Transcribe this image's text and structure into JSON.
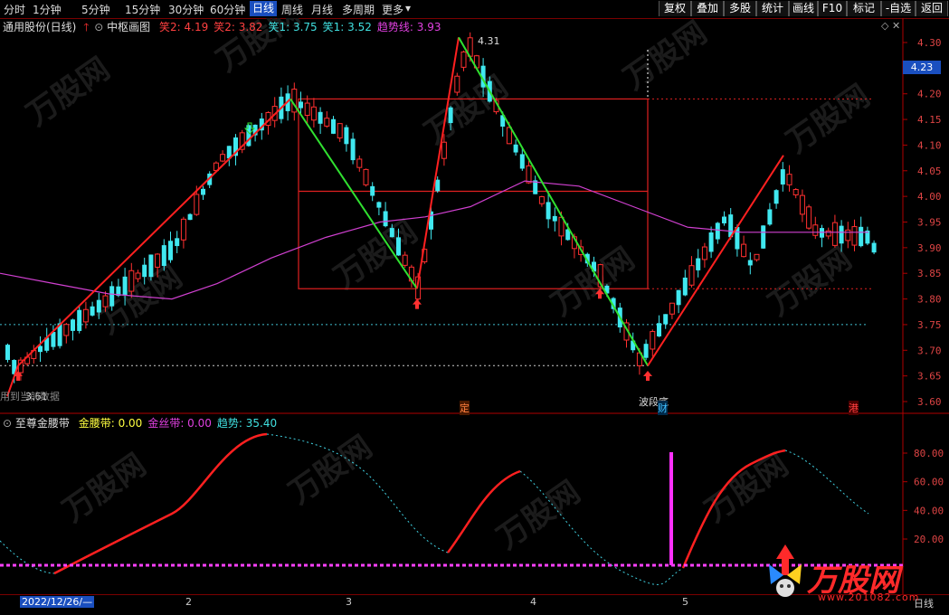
{
  "toolbar": {
    "periods": [
      "分时",
      "1分钟",
      "5分钟",
      "15分钟",
      "30分钟",
      "60分钟",
      "日线",
      "周线",
      "月线",
      "多周期",
      "更多"
    ],
    "active_period": "日线",
    "right_buttons": [
      "复权",
      "叠加",
      "多股",
      "统计",
      "画线",
      "F10",
      "标记",
      "-自选",
      "返回"
    ]
  },
  "main": {
    "stock_title": "通用股份(日线)",
    "indicator_name": "中枢画图",
    "legend": [
      {
        "label": "笑2:",
        "value": "4.19",
        "color": "#ff4040"
      },
      {
        "label": "笑2:",
        "value": "3.82",
        "color": "#ff4040"
      },
      {
        "label": "笑1:",
        "value": "3.75",
        "color": "#40e0e0"
      },
      {
        "label": "笑1:",
        "value": "3.52",
        "color": "#40e0e0"
      },
      {
        "label": "趋势线:",
        "value": "3.93",
        "color": "#e040e0"
      }
    ],
    "price_ticks": [
      "4.30",
      "4.25",
      "4.20",
      "4.15",
      "4.10",
      "4.05",
      "4.00",
      "3.95",
      "3.90",
      "3.85",
      "3.80",
      "3.75",
      "3.70",
      "3.65",
      "3.60"
    ],
    "current_price": "4.23",
    "high_label": "4.31",
    "low_label": "3.61",
    "overlay_text": "用到当前数据",
    "event_labels": [
      "定",
      "财",
      "港"
    ],
    "segment_label": "波段底"
  },
  "sub": {
    "indicator_name": "至尊金腰带",
    "legend": [
      {
        "label": "金腰带:",
        "value": "0.00",
        "color": "#ffff40"
      },
      {
        "label": "金丝带:",
        "value": "0.00",
        "color": "#e040e0"
      },
      {
        "label": "趋势:",
        "value": "35.40",
        "color": "#40e0e0"
      }
    ],
    "ticks": [
      "80.00",
      "60.00",
      "40.00",
      "20.00"
    ]
  },
  "xaxis": {
    "date_label": "2022/12/26/—",
    "months": [
      "2",
      "3",
      "4",
      "5"
    ],
    "right_label": "日线"
  },
  "logo": {
    "brand": "万股网",
    "url": "www.201082.com"
  },
  "colors": {
    "up": "#ff3030",
    "down": "#40e8f0",
    "ma": "#d040d0",
    "zig_up": "#ff2020",
    "zig_down": "#30e030"
  }
}
